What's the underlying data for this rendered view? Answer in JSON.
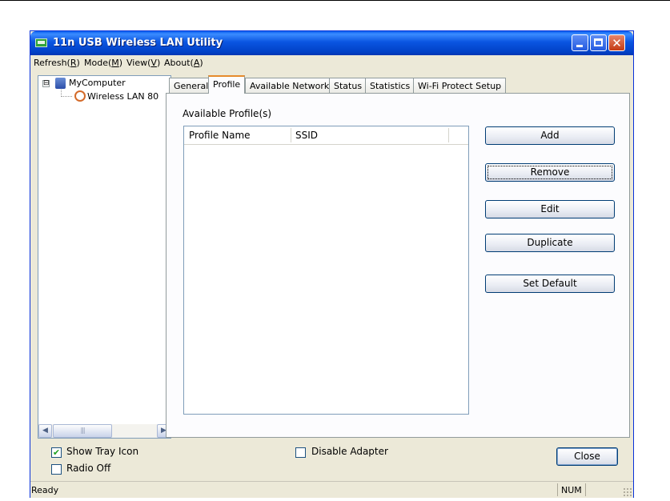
{
  "window": {
    "title": "11n USB Wireless LAN Utility",
    "accent": "#0a55e1"
  },
  "menu": [
    {
      "label": "Refresh(",
      "key": "R",
      "suffix": ")"
    },
    {
      "label": "Mode(",
      "key": "M",
      "suffix": ")"
    },
    {
      "label": "View(",
      "key": "V",
      "suffix": ")"
    },
    {
      "label": "About(",
      "key": "A",
      "suffix": ")"
    }
  ],
  "tree": {
    "root": "MyComputer",
    "child": "Wireless LAN 80",
    "expander": "⊟"
  },
  "tabs": [
    "General",
    "Profile",
    "Available Network",
    "Status",
    "Statistics",
    "Wi-Fi Protect Setup"
  ],
  "active_tab": "Profile",
  "profile": {
    "section_label": "Available Profile(s)",
    "columns": [
      "Profile Name",
      "SSID"
    ],
    "rows": []
  },
  "buttons": {
    "add": "Add",
    "remove": "Remove",
    "edit": "Edit",
    "duplicate": "Duplicate",
    "set_default": "Set Default",
    "close": "Close"
  },
  "options": {
    "show_tray_icon": {
      "label": "Show Tray Icon",
      "checked": true
    },
    "radio_off": {
      "label": "Radio Off",
      "checked": false
    },
    "disable_adapter": {
      "label": "Disable Adapter",
      "checked": false
    }
  },
  "statusbar": {
    "text": "Ready",
    "num": "NUM"
  }
}
